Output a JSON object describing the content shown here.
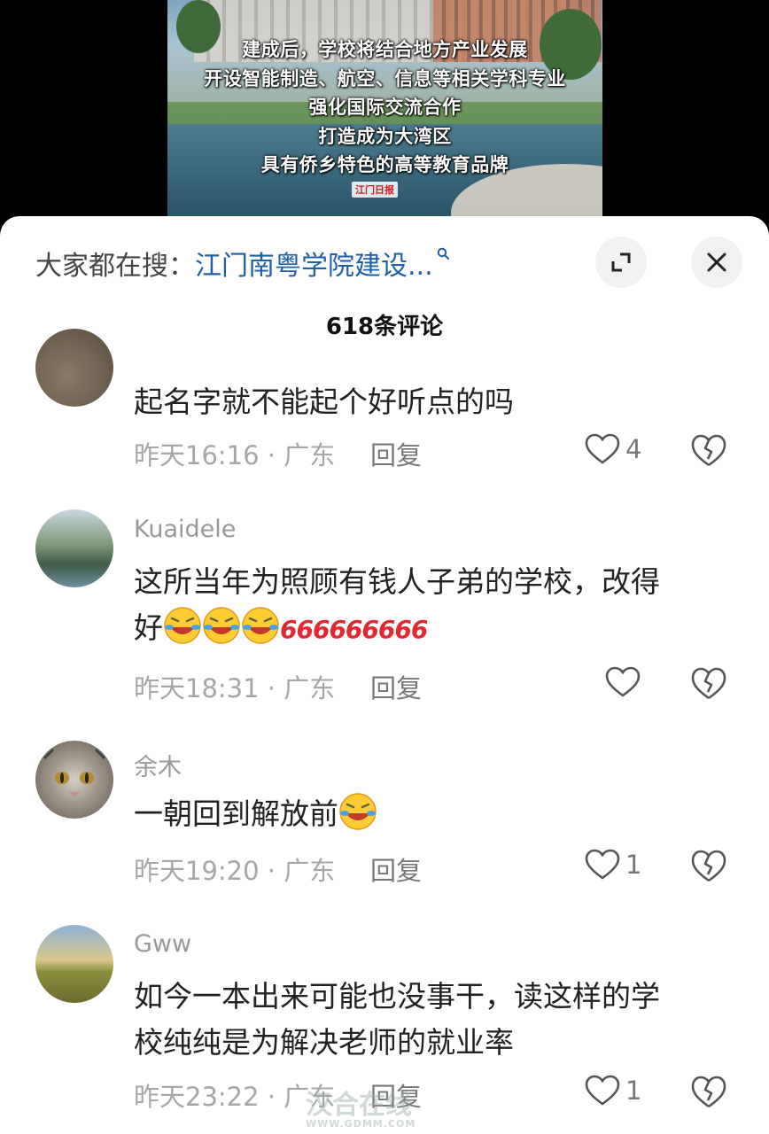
{
  "video": {
    "caption_lines": [
      "建成后，学校将结合地方产业发展",
      "开设智能制造、航空、信息等相关学科专业",
      "强化国际交流合作",
      "打造成为大湾区",
      "具有侨乡特色的高等教育品牌"
    ],
    "logo_text": "江门日报"
  },
  "search": {
    "prefix": "大家都在搜：",
    "term": "江门南粤学院建设..."
  },
  "comments_count": "618条评论",
  "comments": [
    {
      "username": "",
      "text": "起名字就不能起个好听点的吗",
      "time": "昨天16:16 · 广东",
      "reply": "回复",
      "likes": "4"
    },
    {
      "username": "Kuaidele",
      "text_line1": "这所当年为照顾有钱人子弟的学校，改得",
      "text_line2_prefix": "好",
      "text_line2_suffix": "666666666",
      "time": "昨天18:31 · 广东",
      "reply": "回复",
      "likes": ""
    },
    {
      "username": "余木",
      "text": "一朝回到解放前",
      "time": "昨天19:20 · 广东",
      "reply": "回复",
      "likes": "1"
    },
    {
      "username": "Gww",
      "text_line1": "如今一本出来可能也没事干，读这样的学",
      "text_line2": "校纯纯是为解决老师的就业率",
      "time": "昨天23:22 · 广东",
      "reply": "回复",
      "likes": "1"
    }
  ],
  "watermark": {
    "text": "汉合在线",
    "url_text": "WWW.GDMM.COM"
  },
  "colors": {
    "search_term": "#1e5fa8",
    "sheet_bg": "#ffffff",
    "six_red": "#e0282e"
  }
}
